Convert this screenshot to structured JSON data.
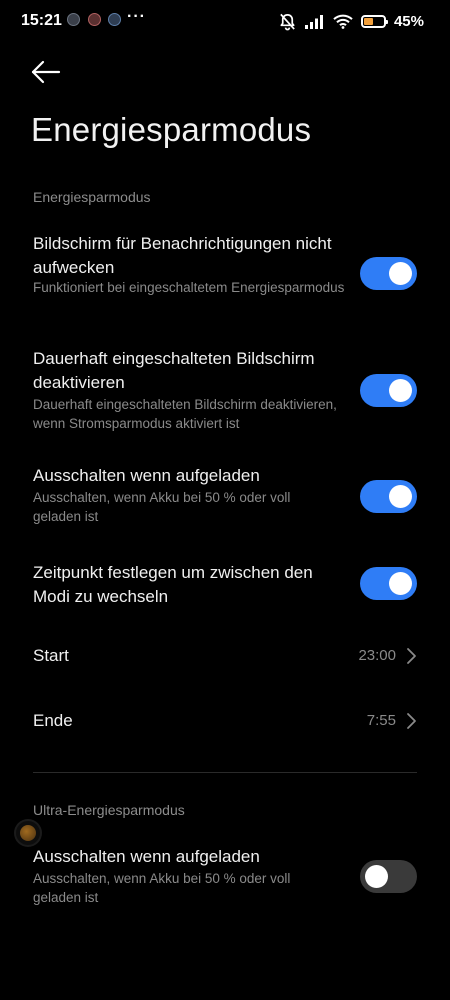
{
  "status_bar": {
    "time": "15:21",
    "more": "···",
    "battery_percent": "45%",
    "battery_level": 0.45,
    "battery_color": "#f2a03c",
    "icons": [
      "notification-app-icon-1",
      "notification-app-icon-2",
      "notification-app-icon-3",
      "mute-bell-icon",
      "signal-icon",
      "wifi-icon",
      "battery-icon"
    ]
  },
  "header": {
    "title": "Energiesparmodus"
  },
  "sections": [
    {
      "header": "Energiesparmodus",
      "items": [
        {
          "title": "Bildschirm für Benachrichtigungen nicht aufwecken",
          "subtitle": "Funktioniert bei eingeschaltetem Energiesparmodus",
          "type": "toggle",
          "on": true
        },
        {
          "title": "Dauerhaft eingeschalteten Bildschirm deaktivieren",
          "subtitle": "Dauerhaft eingeschalteten Bildschirm deaktivieren, wenn Stromsparmodus aktiviert ist",
          "type": "toggle",
          "on": true
        },
        {
          "title": "Ausschalten wenn aufgeladen",
          "subtitle": "Ausschalten, wenn Akku bei 50 % oder voll geladen ist",
          "type": "toggle",
          "on": true
        },
        {
          "title": "Zeitpunkt festlegen um zwischen den Modi zu wechseln",
          "type": "toggle",
          "on": true
        },
        {
          "title": "Start",
          "value": "23:00",
          "type": "link"
        },
        {
          "title": "Ende",
          "value": "7:55",
          "type": "link"
        }
      ]
    },
    {
      "header": "Ultra-Energiesparmodus",
      "items": [
        {
          "title": "Ausschalten wenn aufgeladen",
          "subtitle": "Ausschalten, wenn Akku bei 50 % oder voll geladen ist",
          "type": "toggle",
          "on": false
        }
      ]
    }
  ],
  "colors": {
    "background": "#000000",
    "accent": "#2f7df6",
    "toggle_off": "#3a3a3a",
    "secondary_text": "#8a8a8a"
  }
}
